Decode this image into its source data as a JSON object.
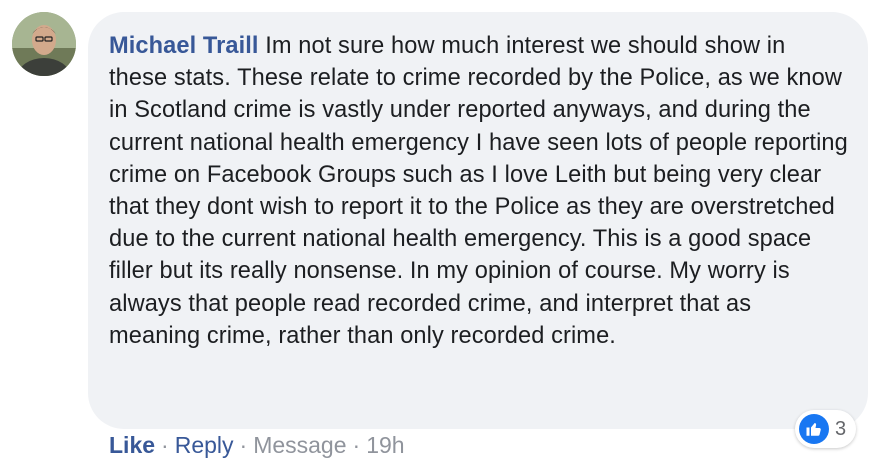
{
  "comment": {
    "author": "Michael Traill",
    "text": "Im not sure how much interest we should show in these stats. These relate to crime recorded by the Police, as we know in Scotland crime is vastly under reported anyways, and during the current national health emergency I have seen lots of people reporting crime on Facebook Groups such as I love Leith but being very clear that they dont wish to report it to the Police as they are overstretched due to the current national health emergency. This is a good space filler but its really nonsense. In my opinion of course. My worry is always that people read recorded crime, and interpret that as meaning crime, rather than only recorded crime."
  },
  "reactions": {
    "icon": "thumbs-up-icon",
    "count": "3",
    "color": "#1877f2"
  },
  "actions": {
    "like": "Like",
    "reply": "Reply",
    "message": "Message",
    "time": "19h",
    "separator": "·"
  },
  "colors": {
    "bubble": "#f0f2f5",
    "author": "#385898",
    "muted": "#90949c"
  }
}
